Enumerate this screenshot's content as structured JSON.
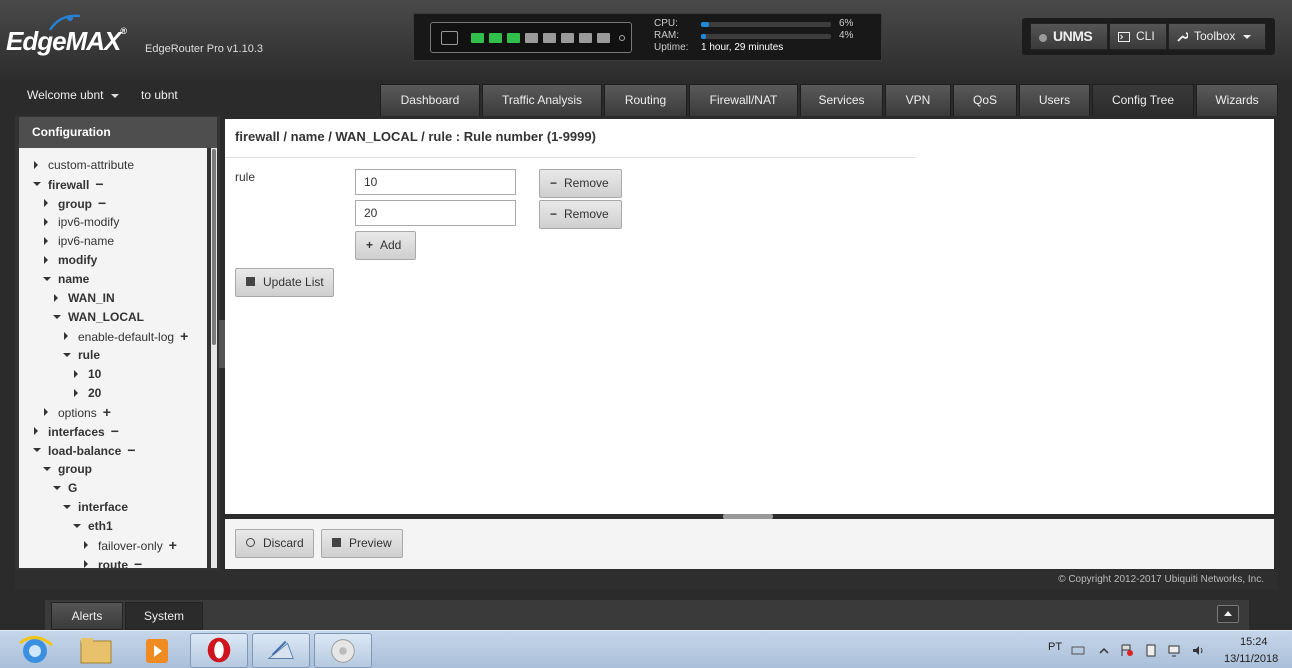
{
  "header": {
    "logo": "EdgeMAX",
    "logo_reg": "®",
    "model": "EdgeRouter Pro v1.10.3",
    "ports": [
      "on",
      "on",
      "on",
      "off",
      "off",
      "off",
      "off",
      "off"
    ],
    "cpu_label": "CPU:",
    "cpu_pct": "6%",
    "cpu_value": 6,
    "ram_label": "RAM:",
    "ram_pct": "4%",
    "ram_value": 4,
    "uptime_label": "Uptime:",
    "uptime_value": "1 hour, 29 minutes",
    "unms": "UNMS",
    "cli": "CLI",
    "toolbox": "Toolbox"
  },
  "user": {
    "welcome": "Welcome ubnt",
    "to": "to ubnt"
  },
  "tabs": [
    {
      "label": "Dashboard"
    },
    {
      "label": "Traffic Analysis"
    },
    {
      "label": "Routing"
    },
    {
      "label": "Firewall/NAT"
    },
    {
      "label": "Services"
    },
    {
      "label": "VPN"
    },
    {
      "label": "QoS"
    },
    {
      "label": "Users"
    },
    {
      "label": "Config Tree",
      "active": true
    },
    {
      "label": "Wizards"
    }
  ],
  "sidebar": {
    "title": "Configuration",
    "tree": [
      {
        "label": "custom-attribute",
        "arrow": "right",
        "bold": false,
        "act": ""
      },
      {
        "label": "firewall",
        "arrow": "down",
        "bold": true,
        "act": "−"
      },
      {
        "label": "group",
        "arrow": "right",
        "bold": true,
        "act": "−"
      },
      {
        "label": "ipv6-modify",
        "arrow": "right",
        "bold": false,
        "act": ""
      },
      {
        "label": "ipv6-name",
        "arrow": "right",
        "bold": false,
        "act": ""
      },
      {
        "label": "modify",
        "arrow": "right",
        "bold": true,
        "act": ""
      },
      {
        "label": "name",
        "arrow": "down",
        "bold": true,
        "act": ""
      },
      {
        "label": "WAN_IN",
        "arrow": "right",
        "bold": true,
        "act": ""
      },
      {
        "label": "WAN_LOCAL",
        "arrow": "down",
        "bold": true,
        "act": ""
      },
      {
        "label": "enable-default-log",
        "arrow": "right",
        "bold": false,
        "act": "+"
      },
      {
        "label": "rule",
        "arrow": "down",
        "bold": true,
        "act": ""
      },
      {
        "label": "10",
        "arrow": "right",
        "bold": true,
        "act": ""
      },
      {
        "label": "20",
        "arrow": "right",
        "bold": true,
        "act": ""
      },
      {
        "label": "options",
        "arrow": "right",
        "bold": false,
        "act": "+"
      },
      {
        "label": "interfaces",
        "arrow": "right",
        "bold": true,
        "act": "−"
      },
      {
        "label": "load-balance",
        "arrow": "down",
        "bold": true,
        "act": "−"
      },
      {
        "label": "group",
        "arrow": "down",
        "bold": true,
        "act": ""
      },
      {
        "label": "G",
        "arrow": "down",
        "bold": true,
        "act": ""
      },
      {
        "label": "interface",
        "arrow": "down",
        "bold": true,
        "act": ""
      },
      {
        "label": "eth1",
        "arrow": "down",
        "bold": true,
        "act": ""
      },
      {
        "label": "failover-only",
        "arrow": "right",
        "bold": false,
        "act": "+"
      },
      {
        "label": "route",
        "arrow": "right",
        "bold": true,
        "act": "−"
      }
    ]
  },
  "main": {
    "breadcrumb": "firewall / name / WAN_LOCAL / rule : Rule number (1-9999)",
    "field_label": "rule",
    "values": [
      "10",
      "20"
    ],
    "remove_label": "Remove",
    "add_label": "Add",
    "update_label": "Update List",
    "discard_label": "Discard",
    "preview_label": "Preview"
  },
  "footer": {
    "copyright": "© Copyright 2012-2017 Ubiquiti Networks, Inc."
  },
  "bottom_tabs": [
    {
      "label": "Alerts"
    },
    {
      "label": "System"
    }
  ],
  "taskbar": {
    "lang": "PT",
    "time": "15:24",
    "date": "13/11/2018"
  },
  "colors": {
    "port_on": "#2fbf4a",
    "port_off": "#9a9a9a",
    "accent": "#1e8ad6"
  }
}
